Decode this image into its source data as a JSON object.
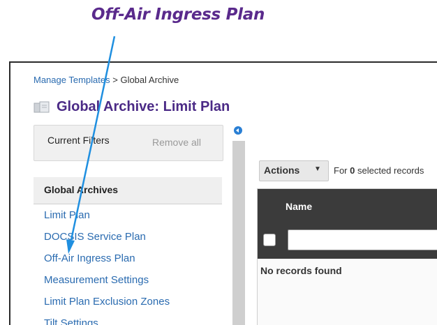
{
  "callout": {
    "label": "Off-Air Ingress Plan"
  },
  "breadcrumb": {
    "link": "Manage Templates",
    "separator": ">",
    "current": "Global Archive"
  },
  "page": {
    "title": "Global Archive: Limit Plan",
    "title_icon": "template-icon"
  },
  "filters": {
    "title": "Current Filters",
    "remove_all": "Remove all"
  },
  "sidebar": {
    "section_title": "Global Archives",
    "items": [
      {
        "label": "Limit Plan"
      },
      {
        "label": "DOCSIS Service Plan"
      },
      {
        "label": "Off-Air Ingress Plan"
      },
      {
        "label": "Measurement Settings"
      },
      {
        "label": "Limit Plan Exclusion Zones"
      },
      {
        "label": "Tilt Settings"
      }
    ]
  },
  "toolbar": {
    "actions_label": "Actions",
    "actions_caret": "▼",
    "for_prefix": "For",
    "selected_count": "0",
    "selected_suffix": "selected records"
  },
  "grid": {
    "column_name": "Name",
    "empty_text": "No records found"
  },
  "colors": {
    "accent_purple": "#4b2a86",
    "link_blue": "#2a6bb0",
    "arrow_blue": "#1f8fe0",
    "grid_header": "#3b3b3b"
  }
}
